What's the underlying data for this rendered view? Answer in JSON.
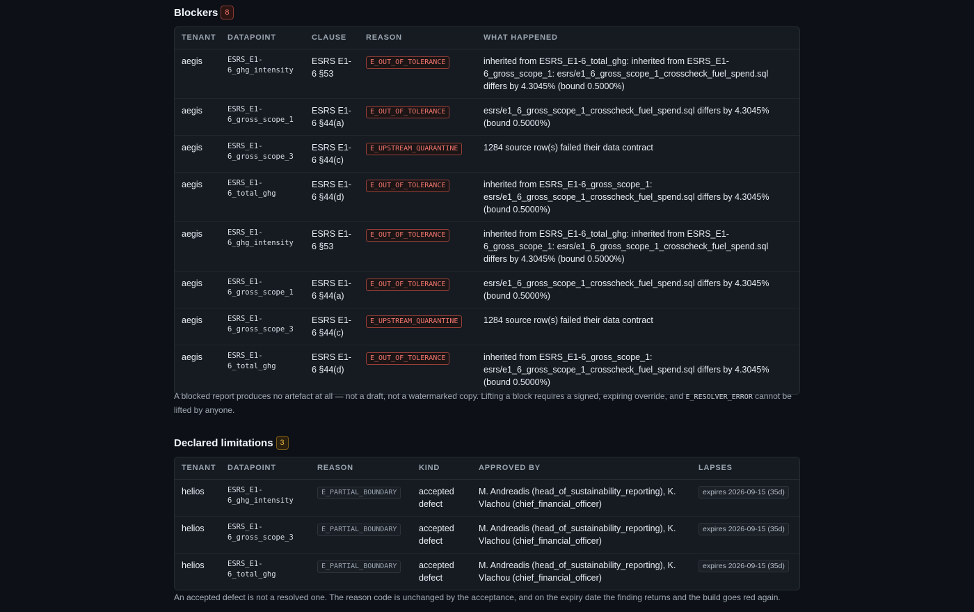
{
  "blockers": {
    "title": "Blockers",
    "count": "8",
    "columns": [
      "TENANT",
      "DATAPOINT",
      "CLAUSE",
      "REASON",
      "WHAT HAPPENED"
    ],
    "rows": [
      {
        "tenant": "aegis",
        "datapoint": "ESRS_E1-6_ghg_intensity",
        "clause": "ESRS E1-6 §53",
        "reason": "E_OUT_OF_TOLERANCE",
        "what": "inherited from ESRS_E1-6_total_ghg: inherited from ESRS_E1-6_gross_scope_1: esrs/e1_6_gross_scope_1_crosscheck_fuel_spend.sql differs by 4.3045% (bound 0.5000%)"
      },
      {
        "tenant": "aegis",
        "datapoint": "ESRS_E1-6_gross_scope_1",
        "clause": "ESRS E1-6 §44(a)",
        "reason": "E_OUT_OF_TOLERANCE",
        "what": "esrs/e1_6_gross_scope_1_crosscheck_fuel_spend.sql differs by 4.3045% (bound 0.5000%)"
      },
      {
        "tenant": "aegis",
        "datapoint": "ESRS_E1-6_gross_scope_3",
        "clause": "ESRS E1-6 §44(c)",
        "reason": "E_UPSTREAM_QUARANTINE",
        "what": "1284 source row(s) failed their data contract"
      },
      {
        "tenant": "aegis",
        "datapoint": "ESRS_E1-6_total_ghg",
        "clause": "ESRS E1-6 §44(d)",
        "reason": "E_OUT_OF_TOLERANCE",
        "what": "inherited from ESRS_E1-6_gross_scope_1: esrs/e1_6_gross_scope_1_crosscheck_fuel_spend.sql differs by 4.3045% (bound 0.5000%)"
      },
      {
        "tenant": "aegis",
        "datapoint": "ESRS_E1-6_ghg_intensity",
        "clause": "ESRS E1-6 §53",
        "reason": "E_OUT_OF_TOLERANCE",
        "what": "inherited from ESRS_E1-6_total_ghg: inherited from ESRS_E1-6_gross_scope_1: esrs/e1_6_gross_scope_1_crosscheck_fuel_spend.sql differs by 4.3045% (bound 0.5000%)"
      },
      {
        "tenant": "aegis",
        "datapoint": "ESRS_E1-6_gross_scope_1",
        "clause": "ESRS E1-6 §44(a)",
        "reason": "E_OUT_OF_TOLERANCE",
        "what": "esrs/e1_6_gross_scope_1_crosscheck_fuel_spend.sql differs by 4.3045% (bound 0.5000%)"
      },
      {
        "tenant": "aegis",
        "datapoint": "ESRS_E1-6_gross_scope_3",
        "clause": "ESRS E1-6 §44(c)",
        "reason": "E_UPSTREAM_QUARANTINE",
        "what": "1284 source row(s) failed their data contract"
      },
      {
        "tenant": "aegis",
        "datapoint": "ESRS_E1-6_total_ghg",
        "clause": "ESRS E1-6 §44(d)",
        "reason": "E_OUT_OF_TOLERANCE",
        "what": "inherited from ESRS_E1-6_gross_scope_1: esrs/e1_6_gross_scope_1_crosscheck_fuel_spend.sql differs by 4.3045% (bound 0.5000%)"
      }
    ],
    "note_before": "A blocked report produces no artefact at all — not a draft, not a watermarked copy. Lifting a block requires a signed, expiring override, and ",
    "note_code": "E_RESOLVER_ERROR",
    "note_after": " cannot be lifted by anyone."
  },
  "limitations": {
    "title": "Declared limitations",
    "count": "3",
    "columns": [
      "TENANT",
      "DATAPOINT",
      "REASON",
      "KIND",
      "APPROVED BY",
      "LAPSES"
    ],
    "rows": [
      {
        "tenant": "helios",
        "datapoint": "ESRS_E1-6_ghg_intensity",
        "reason": "E_PARTIAL_BOUNDARY",
        "kind": "accepted defect",
        "approved": "M. Andreadis (head_of_sustainability_reporting), K. Vlachou (chief_financial_officer)",
        "lapses": "expires 2026-09-15 (35d)"
      },
      {
        "tenant": "helios",
        "datapoint": "ESRS_E1-6_gross_scope_3",
        "reason": "E_PARTIAL_BOUNDARY",
        "kind": "accepted defect",
        "approved": "M. Andreadis (head_of_sustainability_reporting), K. Vlachou (chief_financial_officer)",
        "lapses": "expires 2026-09-15 (35d)"
      },
      {
        "tenant": "helios",
        "datapoint": "ESRS_E1-6_total_ghg",
        "reason": "E_PARTIAL_BOUNDARY",
        "kind": "accepted defect",
        "approved": "M. Andreadis (head_of_sustainability_reporting), K. Vlachou (chief_financial_officer)",
        "lapses": "expires 2026-09-15 (35d)"
      }
    ],
    "note": "An accepted defect is not a resolved one. The reason code is unchanged by the acceptance, and on the expiry date the finding returns and the build goes red again."
  }
}
